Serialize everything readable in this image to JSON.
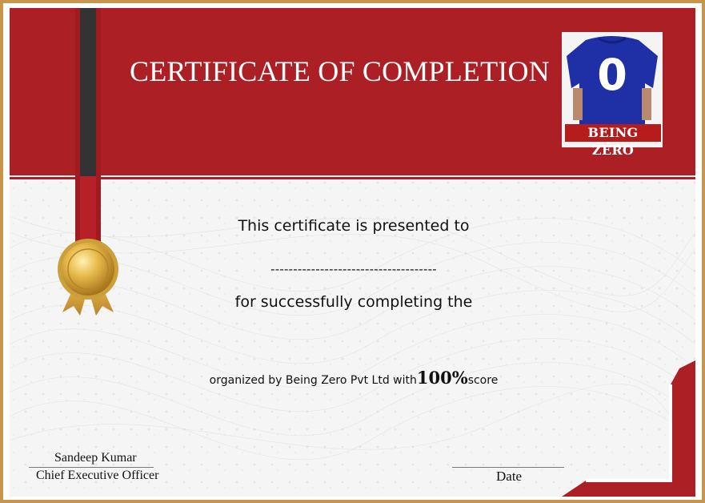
{
  "certificate": {
    "title": "CERTIFICATE OF COMPLETION",
    "presented_text": "This certificate is presented to",
    "name_placeholder": "-------------------------------------",
    "completing_text": "for successfully completing the",
    "organized_prefix": "organized by Being Zero Pvt Ltd with",
    "score_value": "100%",
    "score_suffix": "score"
  },
  "logo": {
    "jersey_number": "0",
    "brand_text": "BEING ZERO"
  },
  "signatures": {
    "name": "Sandeep Kumar",
    "title": "Chief Executive Officer",
    "date_label": "Date"
  },
  "icons": {
    "medal": "gold-medal-icon",
    "logo": "being-zero-jersey-logo"
  },
  "colors": {
    "header_red": "#ab1f25",
    "border_gold": "#c9954c",
    "ribbon_dark": "#333333",
    "jersey_blue": "#1f2fa6"
  }
}
